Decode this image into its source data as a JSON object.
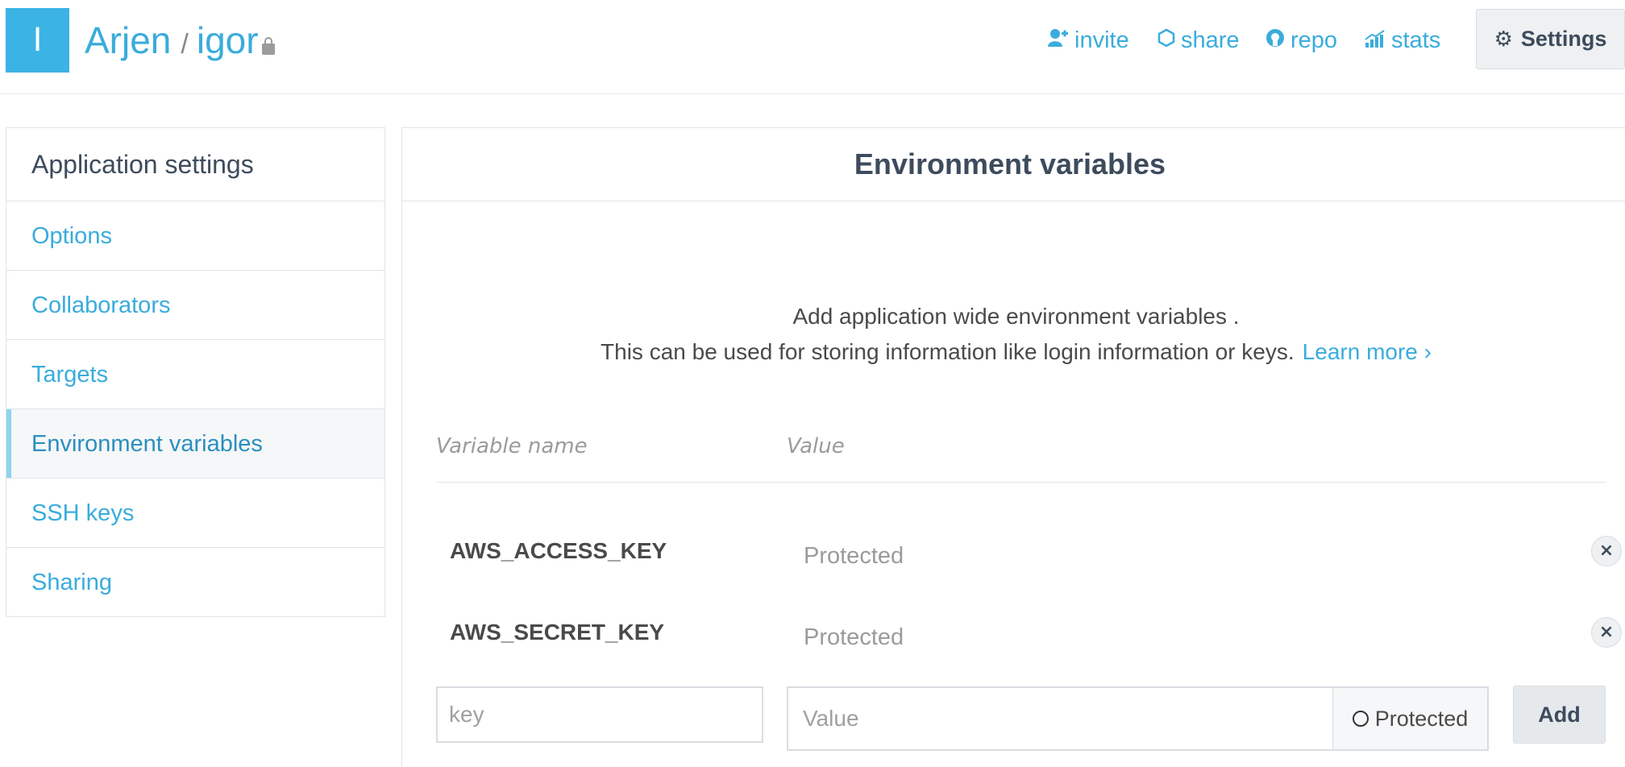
{
  "header": {
    "avatar_letter": "I",
    "owner": "Arjen",
    "separator": "/",
    "project": "igor",
    "nav": {
      "invite": "invite",
      "share": "share",
      "repo": "repo",
      "stats": "stats"
    },
    "settings_label": "Settings"
  },
  "sidebar": {
    "title": "Application settings",
    "items": [
      {
        "label": "Options"
      },
      {
        "label": "Collaborators"
      },
      {
        "label": "Targets"
      },
      {
        "label": "Environment variables",
        "active": true
      },
      {
        "label": "SSH keys"
      },
      {
        "label": "Sharing"
      }
    ]
  },
  "main": {
    "title": "Environment variables",
    "intro_line1": "Add application wide environment variables .",
    "intro_line2": "This can be used for storing information like login information or keys.",
    "learn_more": "Learn more ›",
    "columns": {
      "name": "Variable name",
      "value": "Value"
    },
    "variables": [
      {
        "key": "AWS_ACCESS_KEY",
        "value": "Protected",
        "delete": "×"
      },
      {
        "key": "AWS_SECRET_KEY",
        "value": "Protected",
        "delete": "×"
      }
    ],
    "form": {
      "key_placeholder": "key",
      "value_placeholder": "Value",
      "protected_label": "Protected",
      "add_label": "Add"
    }
  },
  "colors": {
    "accent": "#3aacdc",
    "avatar": "#3bb3e4",
    "text_dark": "#3d4b5c",
    "muted": "#9b9b9b"
  },
  "icons": [
    "invite-icon",
    "share-icon",
    "repo-icon",
    "stats-icon",
    "gear-icon",
    "lock-icon",
    "close-icon",
    "radio-icon"
  ]
}
